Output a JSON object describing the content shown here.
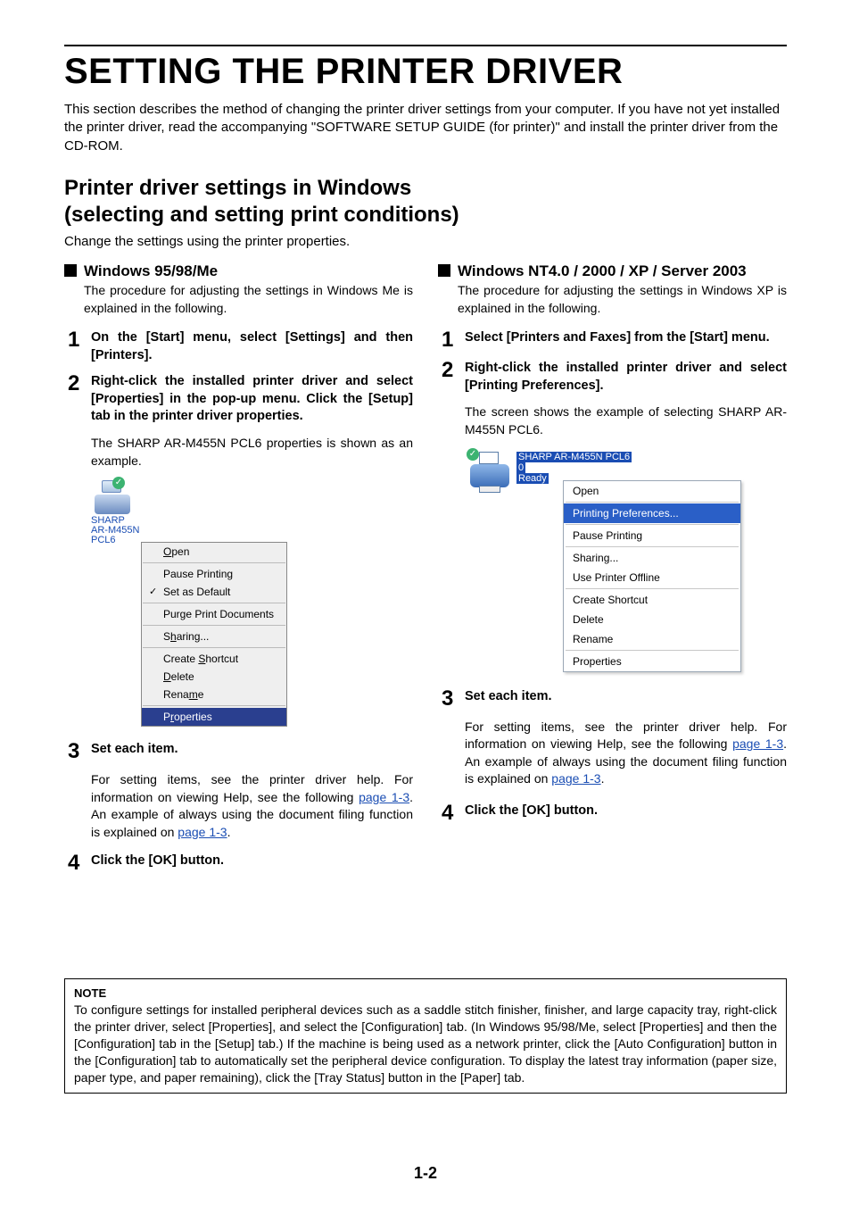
{
  "title": "SETTING THE PRINTER DRIVER",
  "intro": "This section describes the method of changing the printer driver settings from your computer. If you have not yet installed the printer driver, read the accompanying \"SOFTWARE SETUP GUIDE (for printer)\" and install the printer driver from the CD-ROM.",
  "h2a": "Printer driver settings in Windows",
  "h2b": "(selecting and setting print conditions)",
  "sub_intro": "Change the settings using the printer properties.",
  "left": {
    "sec_title": "Windows 95/98/Me",
    "sec_body": "The procedure for adjusting the settings in Windows Me is explained in the following.",
    "steps": {
      "s1": "On the [Start] menu, select [Settings] and then [Printers].",
      "s2": "Right-click the installed printer driver and select [Properties] in the pop-up menu. Click the [Setup] tab in the printer driver properties.",
      "s2_desc": "The SHARP AR-M455N PCL6 properties is shown as an example.",
      "s3": "Set each item.",
      "s3_desc_a": "For setting items, see the printer driver help. For information on viewing Help, see the following ",
      "s3_link1": "page 1-3",
      "s3_desc_b": ". An example of always using the document filing function is explained on ",
      "s3_link2": "page 1-3",
      "s3_desc_c": ".",
      "s4": "Click the [OK] button."
    },
    "printer_label1": "SHARP",
    "printer_label2": "AR-M455N",
    "printer_label3": "PCL6",
    "menu": {
      "open_u": "O",
      "open_r": "pen",
      "pause": "Pause Printing",
      "setdef": "Set as Default",
      "purge": "Purge Print Documents",
      "sharing_a": "S",
      "sharing_u": "h",
      "sharing_b": "aring...",
      "create_a": "Create ",
      "create_u": "S",
      "create_b": "hortcut",
      "delete_u": "D",
      "delete_r": "elete",
      "rename_a": "Rena",
      "rename_u": "m",
      "rename_b": "e",
      "props_a": "P",
      "props_u": "r",
      "props_b": "operties"
    }
  },
  "right": {
    "sec_title": "Windows NT4.0 / 2000 / XP / Server 2003",
    "sec_body": "The procedure for adjusting the settings in Windows XP is explained in the following.",
    "steps": {
      "s1": "Select [Printers and Faxes] from the [Start] menu.",
      "s2": "Right-click the installed printer driver and select [Printing Preferences].",
      "s2_desc": "The screen shows the example of selecting SHARP AR-M455N PCL6.",
      "s3": "Set each item.",
      "s3_desc_a": "For setting items, see the printer driver help. For information on viewing Help, see the following ",
      "s3_link1": "page 1-3",
      "s3_desc_b": ". An example of always using the document filing function is explained on ",
      "s3_link2": "page 1-3",
      "s3_desc_c": ".",
      "s4": "Click the [OK] button."
    },
    "xp_name": "SHARP AR-M455N PCL6",
    "xp_zero": "0",
    "xp_ready": "Ready",
    "menu": {
      "open": "Open",
      "pref": "Printing Preferences...",
      "pause": "Pause Printing",
      "sharing": "Sharing...",
      "offline": "Use Printer Offline",
      "shortcut": "Create Shortcut",
      "delete": "Delete",
      "rename": "Rename",
      "props": "Properties"
    }
  },
  "note": {
    "title": "NOTE",
    "body": "To configure settings for installed peripheral devices such as a saddle stitch finisher, finisher, and large capacity tray, right-click the printer driver, select [Properties], and select the [Configuration] tab. (In Windows 95/98/Me, select [Properties] and then the [Configuration] tab in the [Setup] tab.) If the machine is being used as a network printer, click the [Auto Configuration] button in the [Configuration] tab to automatically set the peripheral device configuration. To display the latest tray information (paper size, paper type, and paper remaining), click the [Tray Status] button in the [Paper] tab."
  },
  "page_num": "1-2"
}
